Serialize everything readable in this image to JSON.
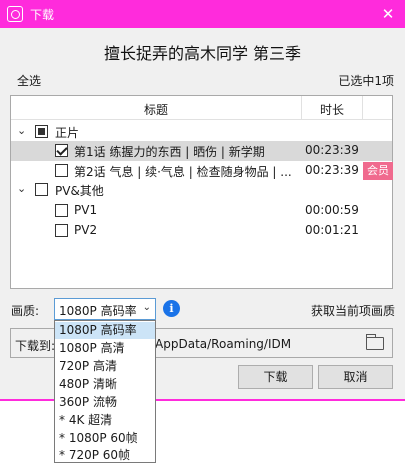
{
  "window": {
    "title": "下载",
    "close_glyph": "✕"
  },
  "page_title": "擅长捉弄的高木同学 第三季",
  "select_all": "全选",
  "selected_count": "已选中1项",
  "tree": {
    "columns": [
      "标题",
      "时长"
    ],
    "groups": [
      {
        "label": "正片",
        "state": "partial",
        "items": [
          {
            "label": "第1话 练握力的东西 | 晒伤 | 新学期",
            "duration": "00:23:39",
            "checked": true,
            "badge": ""
          },
          {
            "label": "第2话 气息 | 续·气息 | 检查随身物品 | ...",
            "duration": "00:23:39",
            "checked": false,
            "badge": "会员"
          }
        ]
      },
      {
        "label": "PV&其他",
        "state": "unchecked",
        "items": [
          {
            "label": "PV1",
            "duration": "00:00:59",
            "checked": false,
            "badge": ""
          },
          {
            "label": "PV2",
            "duration": "00:01:21",
            "checked": false,
            "badge": ""
          }
        ]
      }
    ]
  },
  "quality": {
    "label": "画质:",
    "selected": "1080P 高码率",
    "options": [
      "1080P 高码率",
      "1080P 高清",
      "720P 高清",
      "480P 清晰",
      "360P 流畅",
      "* 4K 超清",
      "* 1080P 60帧",
      "* 720P 60帧"
    ]
  },
  "get_quality_label": "获取当前项画质",
  "download_to": {
    "label": "下载到:",
    "path": "/AppData/Roaming/IDM"
  },
  "buttons": {
    "download": "下载",
    "cancel": "取消"
  },
  "colors": {
    "accent": "#ff2bdc",
    "vip_badge": "#f06a8e",
    "info": "#1a73e8"
  },
  "icons": {
    "app": "app-icon",
    "close": "close-icon",
    "info": "info-icon",
    "folder": "folder-icon",
    "expand": "chevron-down-icon"
  }
}
